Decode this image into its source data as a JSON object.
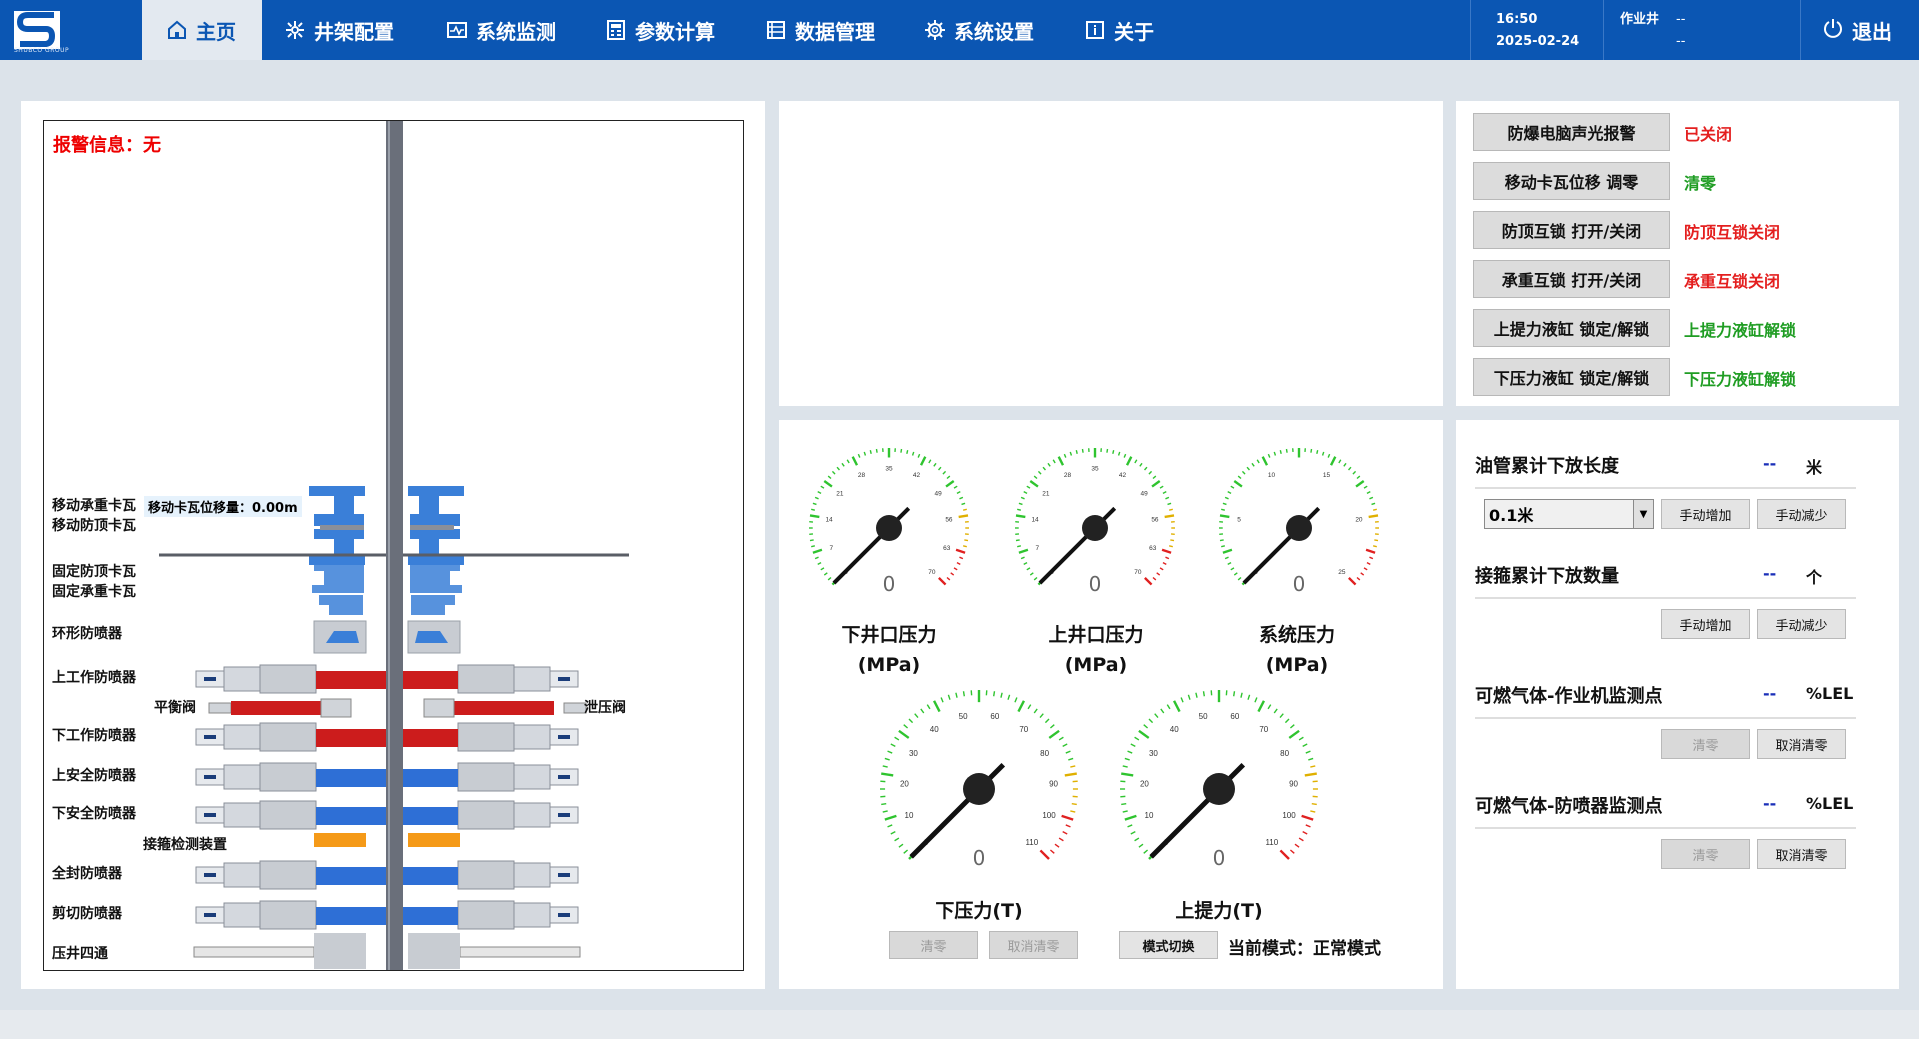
{
  "header": {
    "brand_sub": "SHUBCO GROUP",
    "nav": [
      {
        "label": "主页",
        "icon": "home-icon"
      },
      {
        "label": "井架配置",
        "icon": "derrick-icon"
      },
      {
        "label": "系统监测",
        "icon": "monitor-icon"
      },
      {
        "label": "参数计算",
        "icon": "calculator-icon"
      },
      {
        "label": "数据管理",
        "icon": "database-icon"
      },
      {
        "label": "系统设置",
        "icon": "gear-icon"
      },
      {
        "label": "关于",
        "icon": "info-icon"
      }
    ],
    "time": "16:50",
    "date": "2025-02-24",
    "well_label": "作业井",
    "well_value": "--",
    "well_value2": "--",
    "exit_label": "退出"
  },
  "bop": {
    "alarm": "报警信息：无",
    "displacement_label": "移动卡瓦位移量：",
    "displacement_value": "0.00m",
    "labels": [
      "移动承重卡瓦",
      "移动防顶卡瓦",
      "固定防顶卡瓦",
      "固定承重卡瓦",
      "环形防喷器",
      "上工作防喷器",
      "平衡阀",
      "泄压阀",
      "下工作防喷器",
      "上安全防喷器",
      "下安全防喷器",
      "接箍检测装置",
      "全封防喷器",
      "剪切防喷器",
      "压井四通"
    ]
  },
  "gauges": {
    "top": [
      {
        "title": "下井口压力",
        "unit": "(MPa)",
        "value": "0",
        "max": 70,
        "ticks": [
          "0",
          "7",
          "14",
          "21",
          "28",
          "35",
          "42",
          "49",
          "56",
          "63",
          "70"
        ]
      },
      {
        "title": "上井口压力",
        "unit": "(MPa)",
        "value": "0",
        "max": 70,
        "ticks": [
          "0",
          "7",
          "14",
          "21",
          "28",
          "35",
          "42",
          "49",
          "56",
          "63",
          "70"
        ]
      },
      {
        "title": "系统压力",
        "unit": "(MPa)",
        "value": "0",
        "max": 25,
        "ticks": [
          "0",
          "5",
          "10",
          "15",
          "20",
          "25"
        ]
      }
    ],
    "bottom": [
      {
        "title": "下压力(T)",
        "value": "0",
        "max": 110,
        "ticks": [
          "0",
          "10",
          "20",
          "30",
          "40",
          "50",
          "60",
          "70",
          "80",
          "90",
          "100",
          "110"
        ]
      },
      {
        "title": "上提力(T)",
        "value": "0",
        "max": 110,
        "ticks": [
          "0",
          "10",
          "20",
          "30",
          "40",
          "50",
          "60",
          "70",
          "80",
          "90",
          "100",
          "110"
        ]
      }
    ],
    "clear_label": "清零",
    "cancel_clear_label": "取消清零",
    "mode_switch_label": "模式切换",
    "mode_text": "当前模式：正常模式"
  },
  "controls": [
    {
      "button": "防爆电脑声光报警",
      "status": "已关闭",
      "color": "#e41f1f"
    },
    {
      "button": "移动卡瓦位移 调零",
      "status": "清零",
      "color": "#1f9d23"
    },
    {
      "button": "防顶互锁 打开/关闭",
      "status": "防顶互锁关闭",
      "color": "#e41f1f"
    },
    {
      "button": "承重互锁 打开/关闭",
      "status": "承重互锁关闭",
      "color": "#e41f1f"
    },
    {
      "button": "上提力液缸 锁定/解锁",
      "status": "上提力液缸解锁",
      "color": "#1f9d23"
    },
    {
      "button": "下压力液缸 锁定/解锁",
      "status": "下压力液缸解锁",
      "color": "#1f9d23"
    }
  ],
  "counters": {
    "tubing_title": "油管累计下放长度",
    "tubing_value": "--",
    "tubing_unit": "米",
    "step_select": "0.1米",
    "manual_add": "手动增加",
    "manual_sub": "手动减少",
    "collar_title": "接箍累计下放数量",
    "collar_value": "--",
    "collar_unit": "个",
    "gas1_title": "可燃气体-作业机监测点",
    "gas1_value": "--",
    "gas1_unit": "%LEL",
    "gas2_title": "可燃气体-防喷器监测点",
    "gas2_value": "--",
    "gas2_unit": "%LEL",
    "clear": "清零",
    "cancel_clear": "取消清零"
  }
}
